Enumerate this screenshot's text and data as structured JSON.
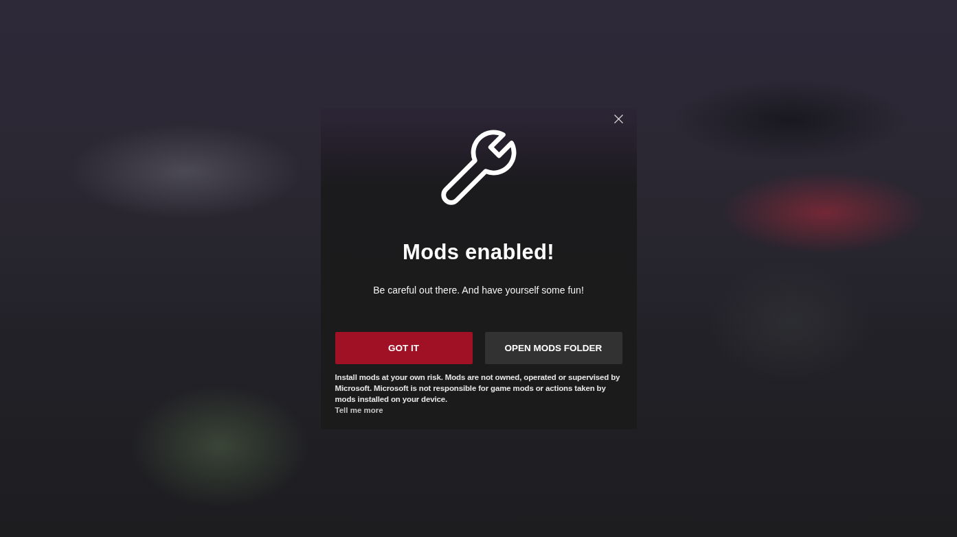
{
  "dialog": {
    "title": "Mods enabled!",
    "message": "Be careful out there. And have yourself some fun!",
    "buttons": [
      {
        "label": "GOT IT",
        "kind": "primary"
      },
      {
        "label": "OPEN MODS FOLDER",
        "kind": "secondary"
      }
    ],
    "disclaimer": "Install mods at your own risk. Mods are not owned, operated or supervised by Microsoft. Microsoft is not responsible for game mods or actions taken by mods installed on your device.",
    "link": "Tell me more"
  }
}
